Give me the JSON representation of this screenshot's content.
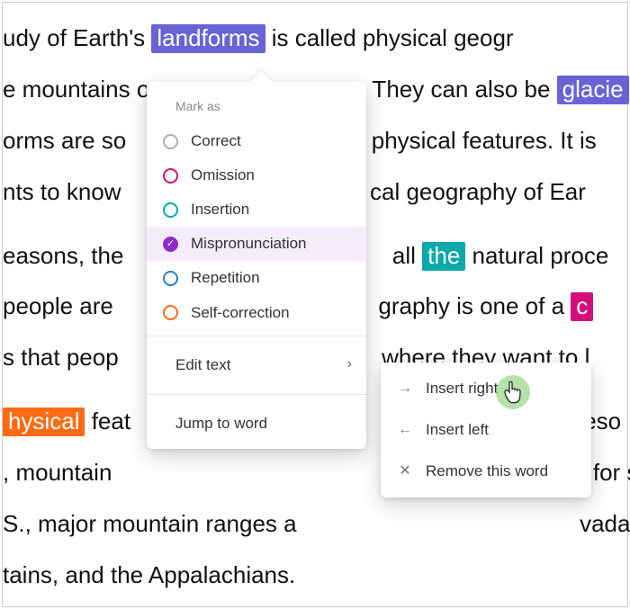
{
  "text": {
    "l1a": "udy of Earth's ",
    "l1hl": "landforms",
    "l1b": " is called physical geogr",
    "l2a": "e mountains or",
    "l2b": ". They can also be ",
    "l2hl": "glacie",
    "l3a": "orms are so",
    "l3b": "physical features. It is",
    "l4a": "nts to know",
    "l4b": "cal geography of Ear",
    "l5a": "easons, the",
    "l5b": "all ",
    "l5hl": "the",
    "l5c": " natural proce",
    "l6a": " people are",
    "l6b": "graphy is one of a ",
    "l6hl": "c",
    "l7a": "s that peop",
    "l7b": "where they want to l",
    "l8hl": "hysical",
    "l8a": " feat",
    "l8b": "reso",
    "l9a": ", mountain",
    "l9b": "for s",
    "l10": "S., major mountain ranges a",
    "l10b": "vada",
    "l11": "tains, and the Appalachians."
  },
  "colors": {
    "purple": "#6964d6",
    "teal": "#0aa8a8",
    "magenta": "#d60e7d",
    "orange": "#ff6a13"
  },
  "menu": {
    "header": "Mark as",
    "options": [
      {
        "label": "Correct",
        "color": "gray"
      },
      {
        "label": "Omission",
        "color": "magenta"
      },
      {
        "label": "Insertion",
        "color": "teal"
      },
      {
        "label": "Mispronunciation",
        "color": "purple",
        "selected": true
      },
      {
        "label": "Repetition",
        "color": "blue"
      },
      {
        "label": "Self-correction",
        "color": "orange"
      }
    ],
    "editText": "Edit text",
    "jumpToWord": "Jump to word"
  },
  "submenu": {
    "insertRight": "Insert right",
    "insertLeft": "Insert left",
    "remove": "Remove this word"
  }
}
